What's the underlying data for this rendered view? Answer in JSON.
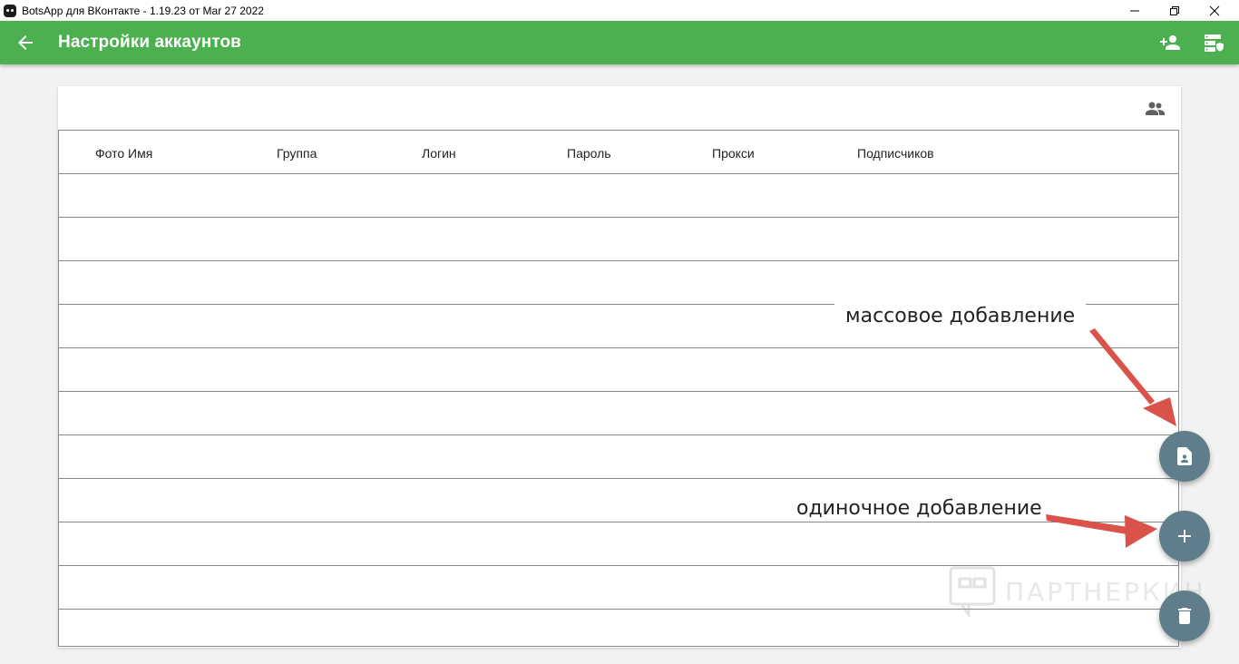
{
  "window": {
    "title": "BotsApp для ВКонтакте - 1.19.23 от Mar 27 2022",
    "controls": [
      "minimize-icon",
      "restore-icon",
      "close-icon"
    ]
  },
  "appbar": {
    "title": "Настройки аккаунтов",
    "back_icon": "arrow-back-icon",
    "actions": [
      "person-add-icon",
      "proxy-settings-icon"
    ],
    "color": "#4caf50"
  },
  "table": {
    "toolbar_icon": "groups-icon",
    "columns": [
      "Фото Имя",
      "Группа",
      "Логин",
      "Пароль",
      "Прокси",
      "Подписчиков"
    ],
    "rows": [
      [],
      [],
      [],
      [],
      [],
      [],
      [],
      [],
      [],
      [],
      []
    ]
  },
  "annotations": {
    "bulk_add": "массовое добавление",
    "single_add": "одиночное добавление",
    "arrow_color": "#d9534a"
  },
  "fabs": {
    "color": "#607d8b",
    "items": [
      "contact-file-icon",
      "add-icon",
      "delete-icon"
    ]
  },
  "watermark": "ПАРТНЕРКИН"
}
